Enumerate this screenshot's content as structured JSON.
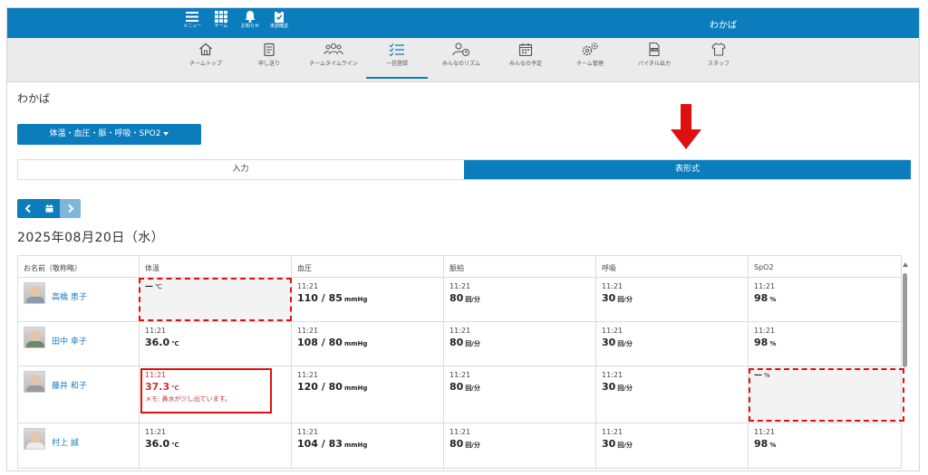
{
  "topbar": {
    "icons": [
      {
        "label": "メニュー",
        "icon": "menu-icon"
      },
      {
        "label": "チーム",
        "icon": "grid-icon"
      },
      {
        "label": "お知らせ",
        "icon": "bell-icon"
      },
      {
        "label": "未読確認",
        "icon": "clipboard-check-icon"
      }
    ],
    "title": "わかば"
  },
  "nav": [
    {
      "label": "チームトップ",
      "icon": "home-icon"
    },
    {
      "label": "申し送り",
      "icon": "notes-icon"
    },
    {
      "label": "チームタイムライン",
      "icon": "people-icon"
    },
    {
      "label": "一括登録",
      "icon": "checklist-icon",
      "active": true
    },
    {
      "label": "みんなのリズム",
      "icon": "person-clock-icon"
    },
    {
      "label": "みんなの予定",
      "icon": "calendar-icon"
    },
    {
      "label": "チーム管理",
      "icon": "gears-icon"
    },
    {
      "label": "バイタル出力",
      "icon": "csv-file-icon"
    },
    {
      "label": "スタッフ",
      "icon": "shirt-icon"
    }
  ],
  "page": {
    "title": "わかば",
    "dropdown": "体温・血圧・脈・呼吸・SPO2",
    "tabs": [
      "入力",
      "表形式"
    ],
    "date": "2025年08月20日（水）"
  },
  "table": {
    "headers": [
      "お名前（敬称略）",
      "体温",
      "血圧",
      "脈拍",
      "呼吸",
      "SpO2"
    ],
    "rows": [
      {
        "name": "高橋 恵子",
        "temp": {
          "empty": true,
          "dash": "—",
          "unit": "℃"
        },
        "bp": {
          "time": "11:21",
          "value": "110 / 85",
          "unit": "mmHg"
        },
        "pulse": {
          "time": "11:21",
          "value": "80",
          "unit": "回/分"
        },
        "resp": {
          "time": "11:21",
          "value": "30",
          "unit": "回/分"
        },
        "spo2": {
          "time": "11:21",
          "value": "98",
          "unit": "%"
        }
      },
      {
        "name": "田中 幸子",
        "temp": {
          "time": "11:21",
          "value": "36.0",
          "unit": "℃"
        },
        "bp": {
          "time": "11:21",
          "value": "108 / 80",
          "unit": "mmHg"
        },
        "pulse": {
          "time": "11:21",
          "value": "80",
          "unit": "回/分"
        },
        "resp": {
          "time": "11:21",
          "value": "30",
          "unit": "回/分"
        },
        "spo2": {
          "time": "11:21",
          "value": "98",
          "unit": "%"
        }
      },
      {
        "name": "藤井 和子",
        "temp": {
          "time": "11:21",
          "value": "37.3",
          "unit": "℃",
          "memo": "メモ: 鼻水が少し出ています。"
        },
        "bp": {
          "time": "11:21",
          "value": "120 / 80",
          "unit": "mmHg"
        },
        "pulse": {
          "time": "11:21",
          "value": "80",
          "unit": "回/分"
        },
        "resp": {
          "time": "11:21",
          "value": "30",
          "unit": "回/分"
        },
        "spo2": {
          "empty": true,
          "dash": "—",
          "unit": "%"
        }
      },
      {
        "name": "村上 誠",
        "temp": {
          "time": "11:21",
          "value": "36.0",
          "unit": "℃"
        },
        "bp": {
          "time": "11:21",
          "value": "104 / 83",
          "unit": "mmHg"
        },
        "pulse": {
          "time": "11:21",
          "value": "80",
          "unit": "回/分"
        },
        "resp": {
          "time": "11:21",
          "value": "30",
          "unit": "回/分"
        },
        "spo2": {
          "time": "11:21",
          "value": "98",
          "unit": "%"
        }
      }
    ]
  },
  "colors": {
    "primary": "#0b7dbd",
    "alert": "#d03030",
    "annotation": "#e01010"
  }
}
